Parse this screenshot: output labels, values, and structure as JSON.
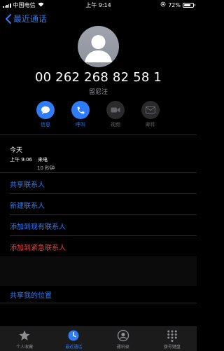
{
  "status": {
    "carrier": "中国电信",
    "network": "",
    "time": "上午 9:14",
    "battery_pct": 72,
    "battery_label": "72%"
  },
  "nav": {
    "back_label": "最近通话"
  },
  "contact": {
    "phone": "00 262 268 82 58 1",
    "name": "留尼汪"
  },
  "actions": [
    {
      "label": "信息",
      "icon": "message-icon",
      "enabled": true
    },
    {
      "label": "呼叫",
      "icon": "phone-icon",
      "enabled": true
    },
    {
      "label": "视频",
      "icon": "video-icon",
      "enabled": false
    },
    {
      "label": "邮件",
      "icon": "mail-icon",
      "enabled": false
    }
  ],
  "recent": {
    "title": "今天",
    "call_time": "上午 9:06",
    "call_type": "来电",
    "duration": "10 秒钟"
  },
  "menu": [
    {
      "label": "共享联系人",
      "color": "#2f7cf6"
    },
    {
      "label": "新建联系人",
      "color": "#2f7cf6"
    },
    {
      "label": "添加到现有联系人",
      "color": "#2f7cf6"
    },
    {
      "label": "添加到紧急联系人",
      "color": "#f0413a"
    }
  ],
  "share_location": {
    "label": "共享我的位置"
  },
  "tabs": [
    {
      "label": "个人收藏",
      "icon": "star-icon",
      "active": false
    },
    {
      "label": "最近通话",
      "icon": "clock-icon",
      "active": true
    },
    {
      "label": "通讯录",
      "icon": "contacts-icon",
      "active": false
    },
    {
      "label": "拨号键盘",
      "icon": "keypad-icon",
      "active": false
    }
  ],
  "colors": {
    "accent": "#2f7cf6",
    "danger": "#f0413a",
    "background": "#000000",
    "tab_bar": "#1b1b1c"
  }
}
